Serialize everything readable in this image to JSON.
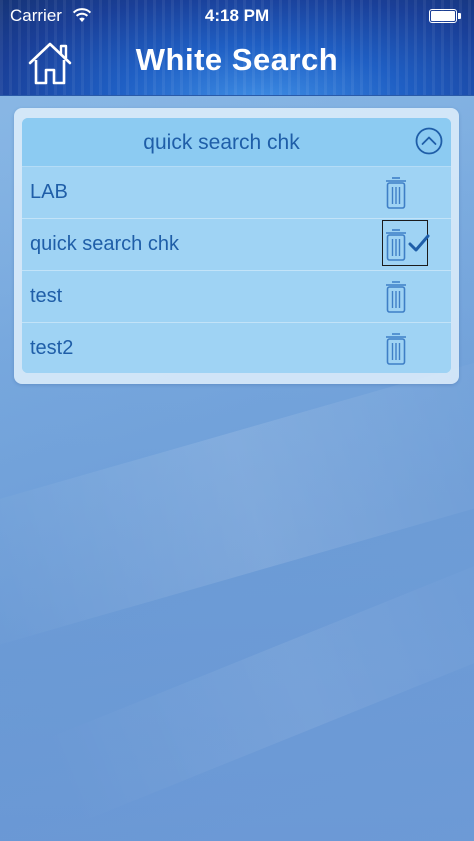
{
  "status_bar": {
    "carrier": "Carrier",
    "time": "4:18 PM",
    "wifi_icon": "wifi-icon",
    "battery_icon": "battery-icon"
  },
  "nav": {
    "title": "White Search",
    "home_icon": "home-icon"
  },
  "search_panel": {
    "header_label": "quick search chk",
    "collapse_icon": "chevron-up-circle-icon",
    "items": [
      {
        "label": "LAB",
        "selected": false,
        "delete_icon": "trash-icon"
      },
      {
        "label": "quick search chk",
        "selected": true,
        "delete_icon": "trash-icon",
        "check_icon": "checkmark-icon"
      },
      {
        "label": "test",
        "selected": false,
        "delete_icon": "trash-icon"
      },
      {
        "label": "test2",
        "selected": false,
        "delete_icon": "trash-icon"
      }
    ]
  },
  "colors": {
    "header_blue": "#1f5fc4",
    "panel_row": "#9fd3f4",
    "text_blue": "#1f5ea8",
    "background": "#76a6dc"
  }
}
